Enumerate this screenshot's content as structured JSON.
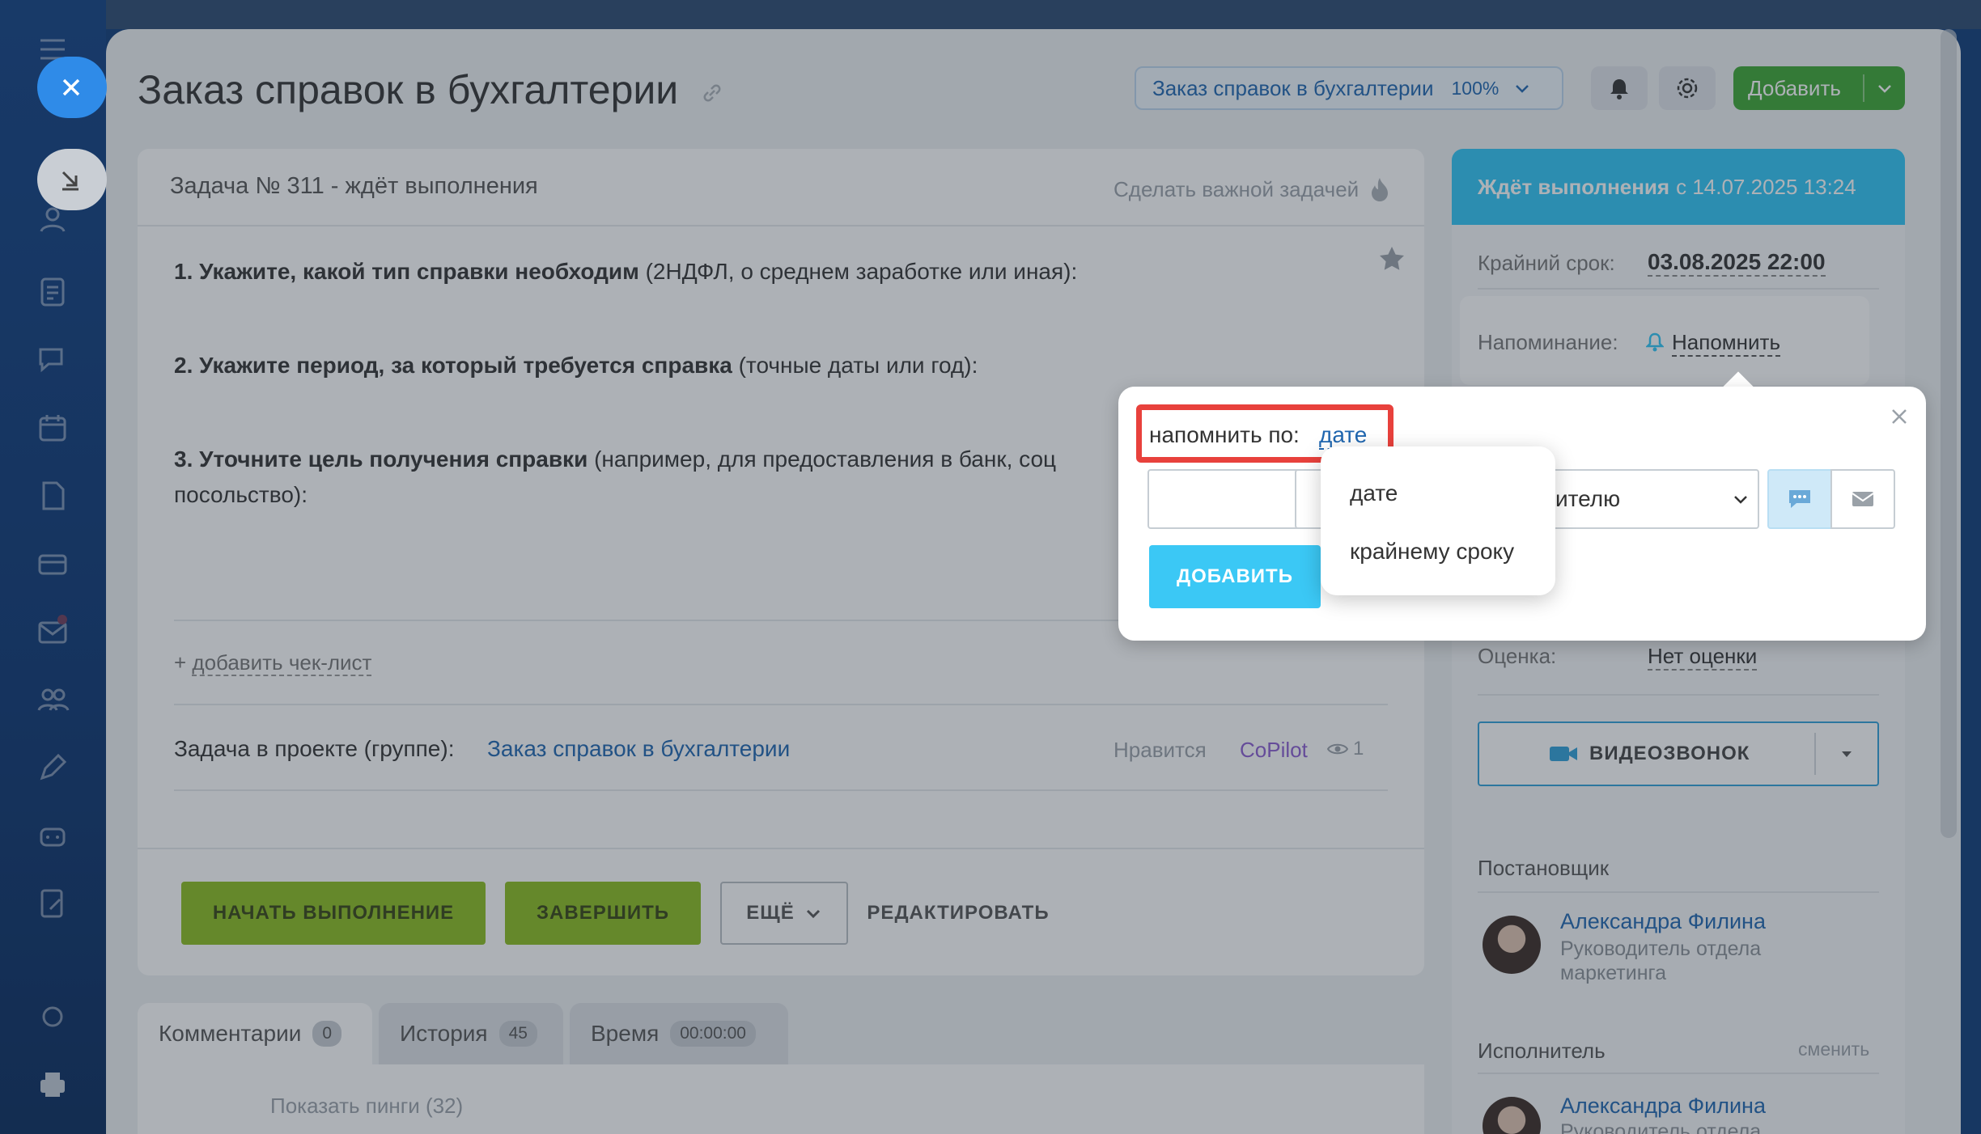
{
  "header": {
    "title": "Заказ справок в бухгалтерии",
    "project_pill": "Заказ справок в бухгалтерии",
    "project_percent": "100%",
    "add_button": "Добавить"
  },
  "task": {
    "status_line": "Задача № 311 - ждёт выполнения",
    "make_important": "Сделать важной задачей",
    "q1_bold": "1. Укажите, какой тип справки необходим",
    "q1_rest": " (2НДФЛ, о среднем заработке или иная):",
    "q2_bold": "2. Укажите период, за который требуется справка",
    "q2_rest": " (точные даты или год):",
    "q3_bold": "3. Уточните цель получения справки",
    "q3_rest": " (например, для предоставления в банк, соц",
    "q3_line2": "посольство):",
    "add_checklist_prefix": "+ ",
    "add_checklist": "добавить чек-лист",
    "project_label": "Задача в проекте (группе):",
    "project_link": "Заказ справок в бухгалтерии",
    "like": "Нравится",
    "copilot": "CoPilot",
    "views": "1"
  },
  "actions": {
    "start": "НАЧАТЬ ВЫПОЛНЕНИЕ",
    "finish": "ЗАВЕРШИТЬ",
    "more": "ЕЩЁ",
    "edit": "РЕДАКТИРОВАТЬ"
  },
  "tabs": [
    {
      "label": "Комментарии",
      "count": "0"
    },
    {
      "label": "История",
      "count": "45"
    },
    {
      "label": "Время",
      "count": "00:00:00"
    }
  ],
  "comments": {
    "show_pings": "Показать пинги (32)"
  },
  "sidebar": {
    "status_bold": "Ждёт выполнения",
    "status_rest": "с 14.07.2025 13:24",
    "deadline_label": "Крайний срок:",
    "deadline_value": "03.08.2025 22:00",
    "reminder_label": "Напоминание:",
    "reminder_value": "Напомнить",
    "rating_label": "Оценка:",
    "rating_value": "Нет оценки",
    "video_call": "ВИДЕОЗВОНОК",
    "creator_label": "Постановщик",
    "creator_name": "Александра Филина",
    "creator_role_1": "Руководитель отдела",
    "creator_role_2": "маркетинга",
    "assignee_label": "Исполнитель",
    "assignee_change": "сменить",
    "assignee_name": "Александра Филина",
    "assignee_role_1": "Руководитель отдела"
  },
  "popup": {
    "remind_by_label": "напомнить по:",
    "remind_by_value": "дате",
    "recipient_select": "ителю",
    "add_button": "ДОБАВИТЬ",
    "dropdown_options": [
      "дате",
      "крайнему сроку"
    ]
  },
  "colors": {
    "accent_blue": "#2fc6f6",
    "link_blue": "#2067b0",
    "green_add": "#3da733",
    "action_green": "#8cbd1f",
    "highlight_red": "#e8413c"
  }
}
